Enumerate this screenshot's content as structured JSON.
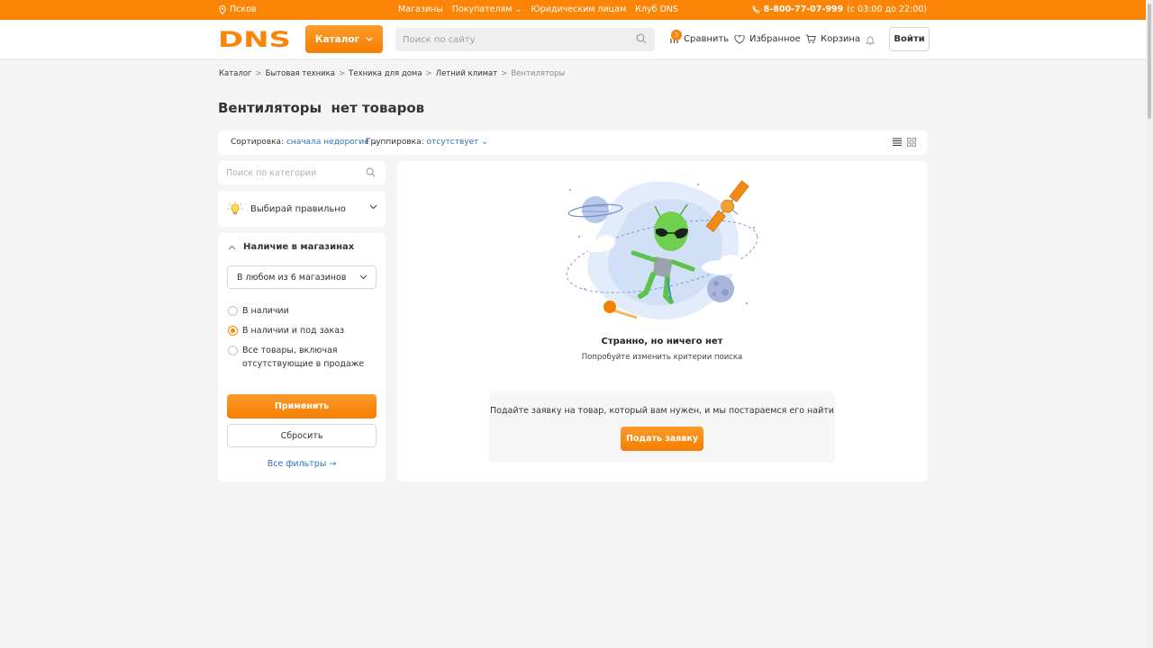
{
  "topbar": {
    "city": "Псков",
    "links": [
      "Магазины",
      "Покупателям",
      "Юридическим лицам",
      "Клуб DNS"
    ],
    "phone": "8-800-77-07-999",
    "hours": "(с 03:00 до 22:00)"
  },
  "header": {
    "logo": "DNS",
    "catalog_label": "Каталог",
    "search_placeholder": "Поиск по сайту",
    "compare_label": "Сравнить",
    "compare_count": "3",
    "favorites_label": "Избранное",
    "cart_label": "Корзина",
    "login_label": "Войти"
  },
  "breadcrumbs": {
    "items": [
      "Каталог",
      "Бытовая техника",
      "Техника для дома",
      "Летний климат",
      "Вентиляторы"
    ],
    "separator": ">"
  },
  "page": {
    "title": "Вентиляторы  нет товаров"
  },
  "sortbar": {
    "sort_label": "Сортировка:",
    "sort_value": "сначала недорогие",
    "group_label": "Группировка:",
    "group_value": "отсутствует"
  },
  "sidebar": {
    "search_placeholder": "Поиск по категории",
    "choose_label": "Выбирай правильно",
    "availability_title": "Наличие в магазинах",
    "store_select_value": "В любом из 6 магазинов",
    "radio_options": [
      {
        "label": "В наличии",
        "checked": false
      },
      {
        "label": "В наличии и под заказ",
        "checked": true
      },
      {
        "label": "Все товары, включая отсутствующие в продаже",
        "checked": false
      }
    ],
    "radio_3_line1": "Все товары, включая",
    "radio_3_line2": "отсутствующие в продаже",
    "apply_label": "Применить",
    "reset_label": "Сбросить",
    "all_filters_label": "Все фильтры →"
  },
  "empty": {
    "title": "Странно, но ничего нет",
    "subtitle": "Попробуйте изменить критерии поиска",
    "request_text": "Подайте заявку на товар, который вам нужен, и мы постараемся его найти",
    "request_button": "Подать заявку"
  },
  "colors": {
    "brand_orange": "#fc8507",
    "link_blue": "#2a74c4",
    "background": "#f5f5f5"
  }
}
